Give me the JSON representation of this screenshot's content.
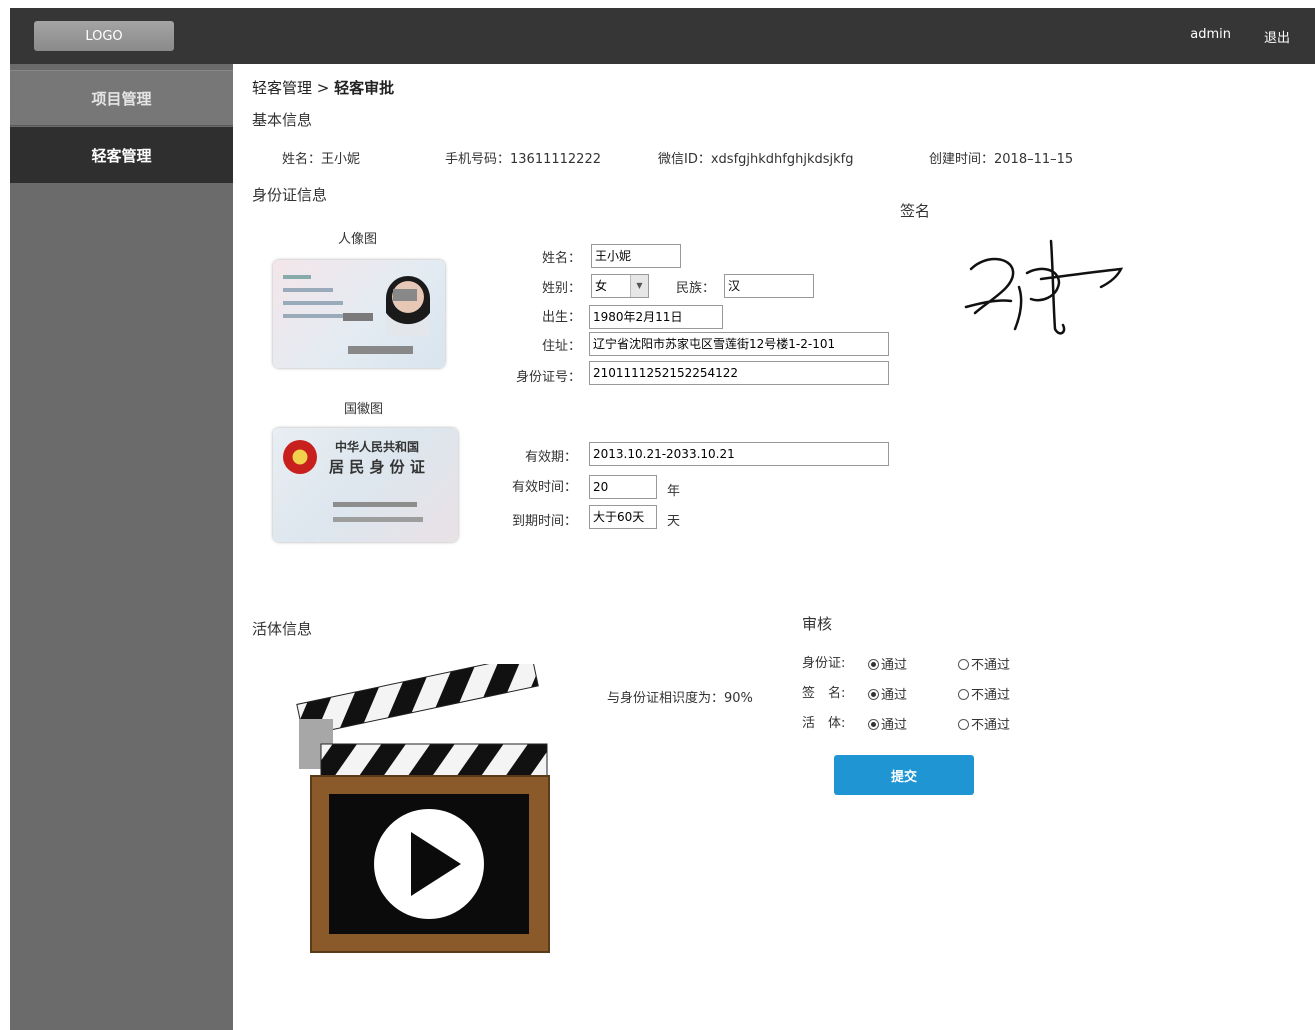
{
  "header": {
    "logo": "LOGO",
    "user": "admin",
    "logout": "退出"
  },
  "sidebar": {
    "items": [
      {
        "label": "项目管理"
      },
      {
        "label": "轻客管理"
      }
    ]
  },
  "breadcrumb": {
    "parent": "轻客管理 >",
    "current": "轻客审批"
  },
  "basic": {
    "title": "基本信息",
    "name_label": "姓名：",
    "name": "王小妮",
    "phone_label": "手机号码：",
    "phone": "13611112222",
    "wechat_label": "微信ID：",
    "wechat": "xdsfgjhkdhfghjkdsjkfg",
    "created_label": "创建时间：",
    "created": "2018–11–15"
  },
  "idinfo": {
    "title": "身份证信息",
    "portrait_label": "人像图",
    "emblem_label": "国徽图",
    "form": {
      "name_label": "姓名：",
      "name": "王小妮",
      "gender_label": "姓别：",
      "gender": "女",
      "ethnic_label": "民族：",
      "ethnic": "汉",
      "birth_label": "出生：",
      "birth": "1980年2月11日",
      "address_label": "住址：",
      "address": "辽宁省沈阳市苏家屯区雪莲街12号楼1-2-101",
      "idno_label": "身份证号：",
      "idno": "2101111252152254122",
      "valid_label": "有效期：",
      "valid": "2013.10.21-2033.10.21",
      "valid_years_label": "有效时间：",
      "valid_years": "20",
      "years_unit": "年",
      "expire_label": "到期时间：",
      "expire": "大于60天",
      "days_unit": "天"
    },
    "card_back": {
      "line1": "中华人民共和国",
      "line2": "居 民 身 份 证"
    }
  },
  "signature": {
    "title": "签名"
  },
  "liveness": {
    "title": "活体信息",
    "similarity": "与身份证相识度为：90%"
  },
  "review": {
    "title": "审核",
    "rows": [
      {
        "label": "身份证:",
        "pass": "通过",
        "fail": "不通过",
        "selected": "pass"
      },
      {
        "label": "签　名:",
        "pass": "通过",
        "fail": "不通过",
        "selected": "pass"
      },
      {
        "label": "活　体:",
        "pass": "通过",
        "fail": "不通过",
        "selected": "pass"
      }
    ],
    "submit": "提交"
  }
}
